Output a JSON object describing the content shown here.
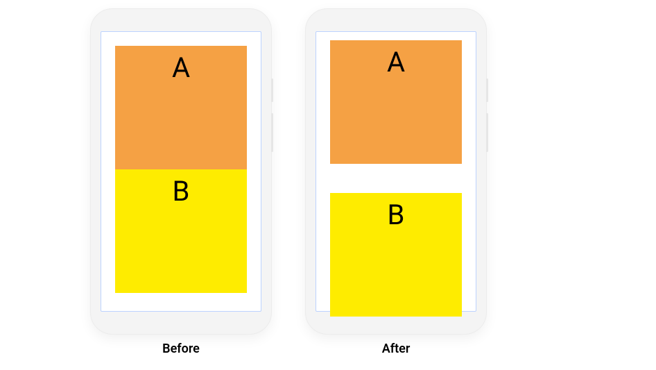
{
  "captions": {
    "before": "Before",
    "after": "After"
  },
  "boxes": {
    "a": "A",
    "b": "B"
  },
  "colors": {
    "box_a": "#f5a144",
    "box_b": "#feec00",
    "screen_border": "#bcd2ff",
    "phone_body": "#f4f4f4"
  }
}
